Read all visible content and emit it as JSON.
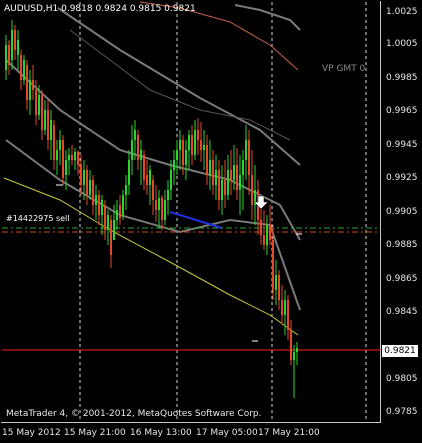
{
  "window": {
    "title": "AUDUSD,H1  0.9818 0.9824 0.9815 0.9821",
    "symbol": "AUDUSD",
    "timeframe": "H1",
    "ohlc": {
      "open": "0.9818",
      "high": "0.9824",
      "low": "0.9815",
      "close": "0.9821"
    }
  },
  "labels": {
    "vp": "VP GMT 0",
    "order": "#14422975 sell",
    "copyright": "MetaTrader 4, © 2001-2012, MetaQuotes Software Corp.",
    "current_price": "0.9821"
  },
  "axes": {
    "y_ticks": [
      "1.0025",
      "1.0005",
      "0.9985",
      "0.9965",
      "0.9945",
      "0.9925",
      "0.9905",
      "0.9885",
      "0.9865",
      "0.9845",
      "0.9825",
      "0.9805",
      "0.9785"
    ],
    "x_ticks": [
      "15 May 2012",
      "15 May 21:00",
      "16 May 13:00",
      "17 May 05:00",
      "17 May 21:00"
    ]
  },
  "colors": {
    "background": "#000000",
    "bull_candle": "#2bd52b",
    "bear_candle": "#e24a2a",
    "order_line": "#2ea82e",
    "current_price_line": "#ff2020",
    "sell_marker": "#ffffff"
  }
}
